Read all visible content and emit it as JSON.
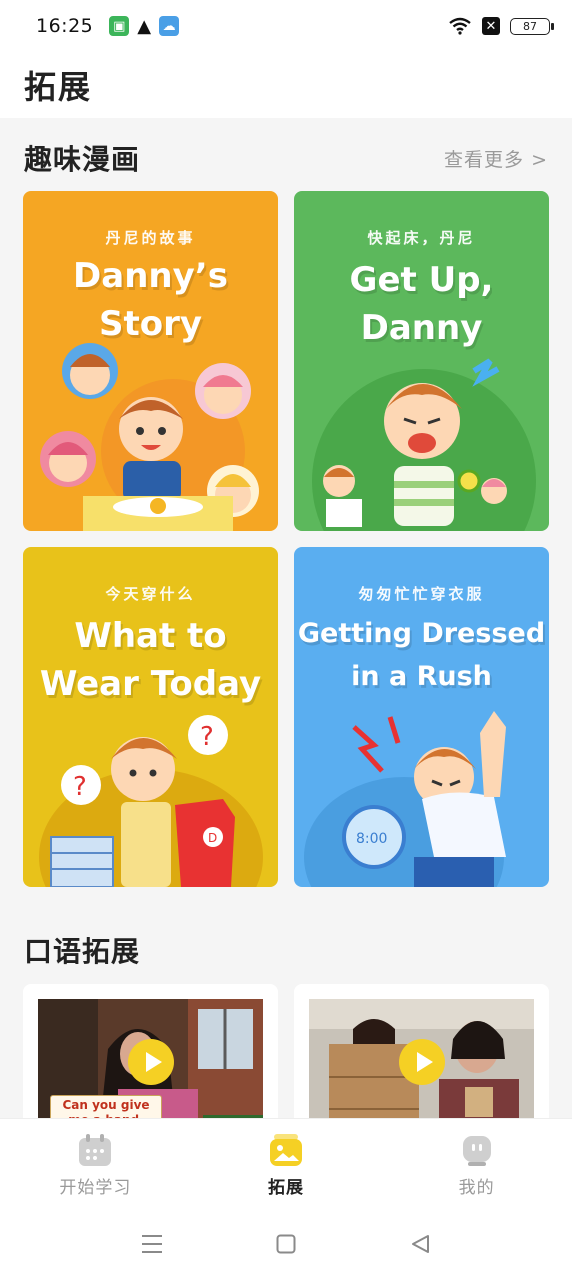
{
  "status_bar": {
    "time": "16:25",
    "battery": "87",
    "icons": [
      "app-icon",
      "warning-icon",
      "cloud-icon",
      "wifi-icon",
      "sim-off-icon",
      "battery-icon"
    ]
  },
  "header": {
    "title": "拓展"
  },
  "comics": {
    "title": "趣味漫画",
    "more": "查看更多 >",
    "cards": [
      {
        "cn": "丹尼的故事",
        "en_line1": "Danny’s",
        "en_line2": "Story",
        "bg": "#f5a623"
      },
      {
        "cn": "快起床，丹尼",
        "en_line1": "Get Up,",
        "en_line2": "Danny",
        "bg": "#5cb85c"
      },
      {
        "cn": "今天穿什么",
        "en_line1": "What to",
        "en_line2": "Wear Today",
        "bg": "#e8c21a"
      },
      {
        "cn": "匆匆忙忙穿衣服",
        "en_line1": "Getting Dressed",
        "en_line2": "in a Rush",
        "bg": "#5aaef0"
      }
    ]
  },
  "oral": {
    "title": "口语拓展",
    "videos": [
      {
        "caption": "Can you give me a hand, please?"
      },
      {
        "caption": ""
      }
    ]
  },
  "bottom_nav": {
    "items": [
      {
        "label": "开始学习",
        "icon": "calendar-icon"
      },
      {
        "label": "拓展",
        "icon": "picture-icon"
      },
      {
        "label": "我的",
        "icon": "robot-icon"
      }
    ],
    "active": "拓展"
  },
  "system_nav": [
    "menu-icon",
    "home-icon",
    "back-icon"
  ],
  "colors": {
    "accent": "#f5d024",
    "muted": "#9a9a9a"
  }
}
